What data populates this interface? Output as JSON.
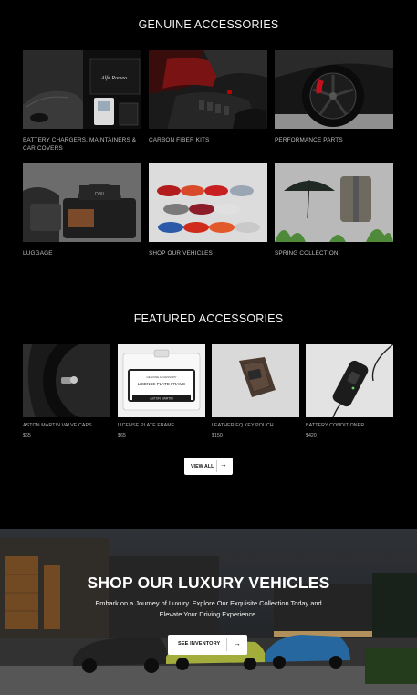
{
  "genuine": {
    "title": "GENUINE ACCESSORIES",
    "tiles": [
      {
        "label": "BATTERY CHARGERS, MAINTAINERS & CAR COVERS"
      },
      {
        "label": "CARBON FIBER KITS"
      },
      {
        "label": "PERFORMANCE PARTS"
      },
      {
        "label": "LUGGAGE"
      },
      {
        "label": "SHOP OUR VEHICLES"
      },
      {
        "label": "SPRING COLLECTION"
      }
    ]
  },
  "featured": {
    "title": "FEATURED ACCESSORIES",
    "items": [
      {
        "name": "ASTON MARTIN VALVE CAPS",
        "price": "$65"
      },
      {
        "name": "LICENSE PLATE FRAME",
        "price": "$65"
      },
      {
        "name": "LEATHER EQ.KEY POUCH",
        "price": "$150"
      },
      {
        "name": "BATTERY CONDITIONER",
        "price": "$420"
      }
    ],
    "plate_text_1": "GENUINE ACCESSORY",
    "plate_text_2": "LICENSE PLATE FRAME",
    "plate_text_3": "ASTON MARTIN",
    "view_all_label": "VIEW ALL"
  },
  "hero": {
    "title": "SHOP OUR LUXURY VEHICLES",
    "subtitle": "Embark on a Journey of Luxury. Explore Our Exquisite Collection Today and Elevate Your Driving Experience.",
    "cta_label": "SEE INVENTORY"
  },
  "icons": {
    "arrow": "arrow-right-icon"
  },
  "colors": {
    "background": "#000000",
    "button_bg": "#ffffff",
    "caption": "#bdbdbd"
  }
}
